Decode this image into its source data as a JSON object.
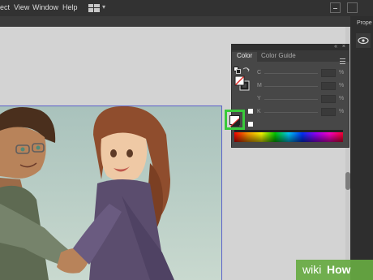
{
  "menubar": {
    "items": [
      "ect",
      "View",
      "Window",
      "Help"
    ]
  },
  "right_dock": {
    "tab_label": "Prope"
  },
  "color_panel": {
    "tabs": [
      "Color",
      "Color Guide"
    ],
    "sliders": [
      {
        "label": "C",
        "unit": "%"
      },
      {
        "label": "M",
        "unit": "%"
      },
      {
        "label": "Y",
        "unit": "%"
      },
      {
        "label": "K",
        "unit": "%"
      }
    ]
  },
  "watermark": {
    "wiki": "wiki",
    "how": "How"
  },
  "colors": {
    "highlight": "#39c93b",
    "panel_bg": "#474747",
    "canvas_bg": "#d3d3d3",
    "artboard_border": "#5b61c9"
  }
}
